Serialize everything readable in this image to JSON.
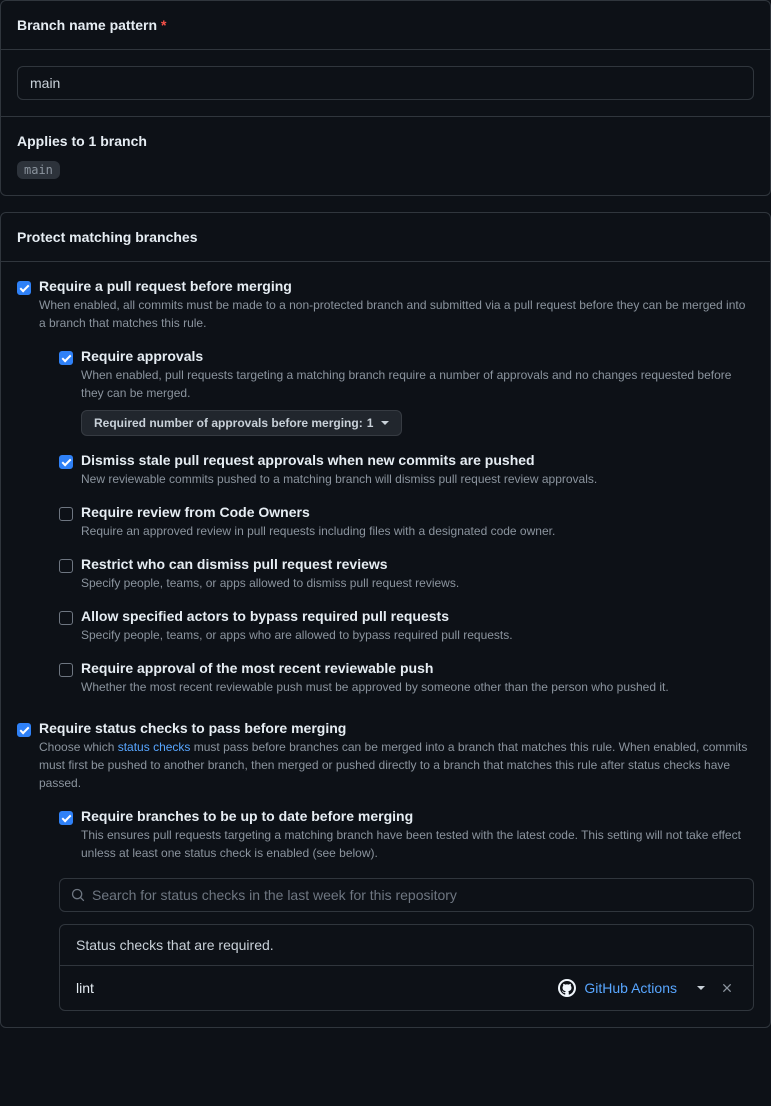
{
  "branch_pattern": {
    "label": "Branch name pattern",
    "value": "main"
  },
  "applies": {
    "title": "Applies to 1 branch",
    "chip": "main"
  },
  "protect": {
    "title": "Protect matching branches",
    "require_pr": {
      "label": "Require a pull request before merging",
      "desc": "When enabled, all commits must be made to a non-protected branch and submitted via a pull request before they can be merged into a branch that matches this rule.",
      "checked": true
    },
    "require_approvals": {
      "label": "Require approvals",
      "desc": "When enabled, pull requests targeting a matching branch require a number of approvals and no changes requested before they can be merged.",
      "checked": true,
      "dropdown_prefix": "Required number of approvals before merging: ",
      "dropdown_value": "1"
    },
    "dismiss_stale": {
      "label": "Dismiss stale pull request approvals when new commits are pushed",
      "desc": "New reviewable commits pushed to a matching branch will dismiss pull request review approvals.",
      "checked": true
    },
    "code_owners": {
      "label": "Require review from Code Owners",
      "desc": "Require an approved review in pull requests including files with a designated code owner.",
      "checked": false
    },
    "restrict_dismiss": {
      "label": "Restrict who can dismiss pull request reviews",
      "desc": "Specify people, teams, or apps allowed to dismiss pull request reviews.",
      "checked": false
    },
    "bypass_actors": {
      "label": "Allow specified actors to bypass required pull requests",
      "desc": "Specify people, teams, or apps who are allowed to bypass required pull requests.",
      "checked": false
    },
    "recent_push": {
      "label": "Require approval of the most recent reviewable push",
      "desc": "Whether the most recent reviewable push must be approved by someone other than the person who pushed it.",
      "checked": false
    },
    "status_checks": {
      "label": "Require status checks to pass before merging",
      "desc_pre": "Choose which ",
      "desc_link": "status checks",
      "desc_post": " must pass before branches can be merged into a branch that matches this rule. When enabled, commits must first be pushed to another branch, then merged or pushed directly to a branch that matches this rule after status checks have passed.",
      "checked": true
    },
    "up_to_date": {
      "label": "Require branches to be up to date before merging",
      "desc": "This ensures pull requests targeting a matching branch have been tested with the latest code. This setting will not take effect unless at least one status check is enabled (see below).",
      "checked": true
    },
    "search_placeholder": "Search for status checks in the last week for this repository",
    "required_header": "Status checks that are required.",
    "required_items": [
      {
        "name": "lint",
        "source": "GitHub Actions"
      }
    ]
  }
}
